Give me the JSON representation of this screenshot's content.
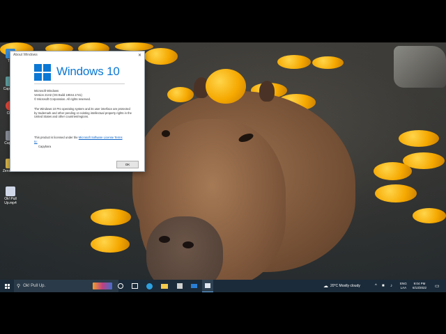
{
  "desktop_icons": [
    {
      "label": "The",
      "color": "#3a8fd9"
    },
    {
      "label": "Capt Exp",
      "color": "#5f9ea0"
    },
    {
      "label": "Chro",
      "color": "#e0463a"
    },
    {
      "label": "Capt Tu",
      "color": "#8a8f99"
    },
    {
      "label": "ZeroOrive",
      "color": "#d6b44a"
    },
    {
      "label": "Ok! Pull Up.mp4",
      "color": "#d0d8e8"
    }
  ],
  "dialog": {
    "title": "About Windows",
    "close_glyph": "✕",
    "brand": "Windows 10",
    "line1": "Microsoft Windows",
    "line2": "Version 21H2 (OS Build 19044.1741)",
    "line3": "© Microsoft Corporation. All rights reserved.",
    "para": "The Windows 10 Pro operating system and its user interface are protected by trademark and other pending or existing intellectual property rights in the United States and other countries/regions.",
    "license_prefix": "This product is licensed under the",
    "license_link": "Microsoft Software License Terms",
    "license_suffix": "to:",
    "licensee": "Capybara",
    "ok_label": "OK"
  },
  "taskbar": {
    "search_text": "Ok! Pull Up.",
    "weather": "20°C  Mostly cloudy",
    "lang_top": "ENG",
    "lang_bottom": "LAA",
    "time": "9:04 PM",
    "date": "6/13/2022",
    "colors": {
      "bg": "#1b2b3a",
      "accent": "#0a78d4"
    }
  }
}
